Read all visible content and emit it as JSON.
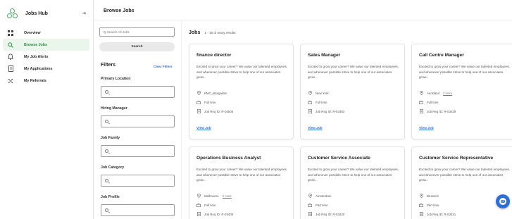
{
  "sidebar": {
    "brand_name": "Jobs Hub",
    "items": [
      {
        "label": "Overview",
        "icon": "grid-icon",
        "active": false
      },
      {
        "label": "Browse Jobs",
        "icon": "search-icon",
        "active": true
      },
      {
        "label": "My Job Alerts",
        "icon": "bell-icon",
        "active": false
      },
      {
        "label": "My Applications",
        "icon": "document-icon",
        "active": false
      },
      {
        "label": "My Referrals",
        "icon": "referral-icon",
        "active": false
      }
    ],
    "collapse_icon": "collapse-sidebar-icon"
  },
  "header": {
    "title": "Browse Jobs"
  },
  "filters": {
    "search_placeholder": "Q  Search All Jobs",
    "search_button": "Search",
    "title": "Filters",
    "clear_label": "Clear Filters",
    "groups": [
      {
        "label": "Primary Location"
      },
      {
        "label": "Hiring Manager"
      },
      {
        "label": "Job Family"
      },
      {
        "label": "Job Category"
      },
      {
        "label": "Job Profile"
      }
    ]
  },
  "jobs": {
    "title": "Jobs",
    "count_text": "1 - 15 of many results",
    "cards": [
      {
        "title": "finance director",
        "description": "Excited to grow your career? We value our talented employees, and whenever possible strive to help one of our associates grow...",
        "location": "KMC_Bangalore",
        "location_more": "",
        "time_type": "Full time",
        "req_id": "Job Req ID: R-03504",
        "view_label": "View Job"
      },
      {
        "title": "Sales Manager",
        "description": "Excited to grow your career? We value our talented employees, and whenever possible strive to help one of our associates grow...",
        "location": "New York",
        "location_more": "",
        "time_type": "Full time",
        "req_id": "Job Req ID: R-03483",
        "view_label": "View Job"
      },
      {
        "title": "Call Centre Manager",
        "description": "Excited to grow your career? We value our talented employees, and whenever possible strive to help one of our associates grow...",
        "location": "Auckland",
        "location_more": "2 more",
        "time_type": "Full time",
        "req_id": "Job Req ID: R-03439",
        "view_label": "View Job"
      },
      {
        "title": "Operations Business Analyst",
        "description": "Excited to grow your career? We value our talented employees, and whenever possible strive to help one of our associates grow...",
        "location": "Melbourne",
        "location_more": "2 more",
        "time_type": "Full time",
        "req_id": "Job Req ID: R-03400",
        "view_label": "View Job"
      },
      {
        "title": "Customer Service Associate",
        "description": "Excited to grow your career? We value our talented employees, and whenever possible strive to help one of our associates grow...",
        "location": "Amsterdam",
        "location_more": "",
        "time_type": "Part time",
        "req_id": "Job Req ID: R-03420",
        "view_label": "View Job"
      },
      {
        "title": "Customer Service Representative",
        "description": "Excited to grow your career? We value our talented employees, and whenever possible strive to help one of our associates grow...",
        "location": "Brussels",
        "location_more": "",
        "time_type": "Part time",
        "req_id": "Job Req ID: R-03421",
        "view_label": "View Job"
      }
    ]
  },
  "colors": {
    "accent_green": "#2e8b43",
    "link_blue": "#2d6fd6",
    "active_bg": "#eaf6ec"
  },
  "chat_icon": "chat-assistant-icon"
}
